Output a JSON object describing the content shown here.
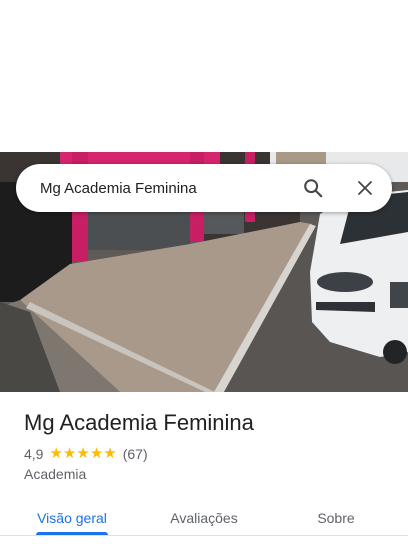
{
  "search": {
    "query": "Mg Academia Feminina"
  },
  "place": {
    "name": "Mg Academia Feminina",
    "rating": "4,9",
    "stars_filled": 5,
    "review_count": "(67)",
    "category": "Academia"
  },
  "tabs": [
    {
      "label": "Visão geral",
      "active": true
    },
    {
      "label": "Avaliações",
      "active": false
    },
    {
      "label": "Sobre",
      "active": false
    }
  ],
  "colors": {
    "accent": "#1a73e8",
    "star": "#fbbc04",
    "storefront": "#d6246e"
  },
  "icons": {
    "search": "search-icon",
    "close": "close-icon",
    "star": "star-icon"
  }
}
